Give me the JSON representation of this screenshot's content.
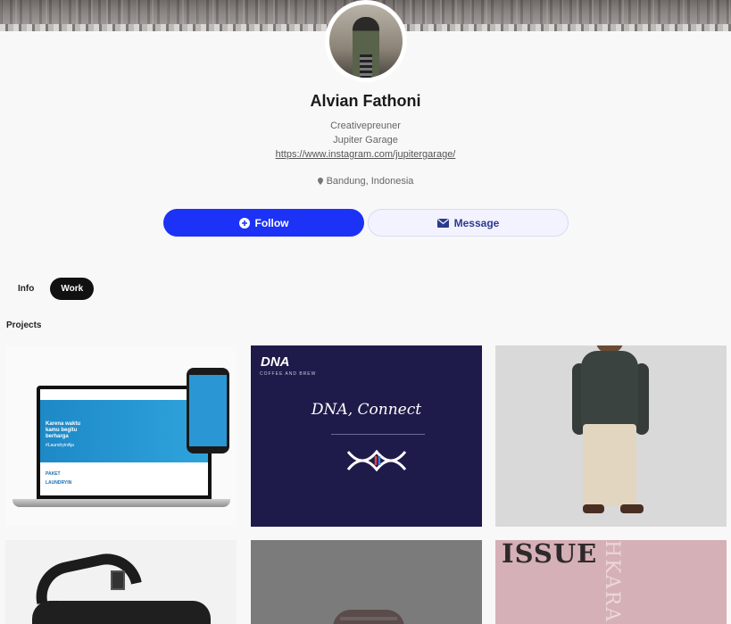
{
  "profile": {
    "name": "Alvian Fathoni",
    "role": "Creativepreuner",
    "company": "Jupiter Garage",
    "link": "https://www.instagram.com/jupitergarage/",
    "location": "Bandung, Indonesia"
  },
  "actions": {
    "follow_label": "Follow",
    "message_label": "Message"
  },
  "tabs": [
    {
      "label": "Info",
      "active": false
    },
    {
      "label": "Work",
      "active": true
    }
  ],
  "section_title": "Projects",
  "colors": {
    "follow_button": "#1c32f6",
    "message_button": "#f2f3ff",
    "active_tab": "#111111"
  },
  "projects": [
    {
      "thumb": "laundryin-web-mockup",
      "texts": [
        "Karena waktu",
        "kamu begitu",
        "berharga",
        "#LaundryinAja",
        "PAKET",
        "LAUNDRYIN"
      ]
    },
    {
      "thumb": "dna-coffee-brand",
      "texts": [
        "DNA",
        "COFFEE AND BREW",
        "DNA, Connect"
      ]
    },
    {
      "thumb": "fashion-model-photo",
      "texts": []
    },
    {
      "thumb": "black-bag-photo",
      "texts": []
    },
    {
      "thumb": "shoes-photo",
      "texts": []
    },
    {
      "thumb": "magazine-cover",
      "texts": [
        "ISSUE",
        "HKARA"
      ]
    }
  ],
  "icons": {
    "follow": "plus-circle-icon",
    "message": "envelope-icon",
    "location": "map-pin-icon"
  }
}
